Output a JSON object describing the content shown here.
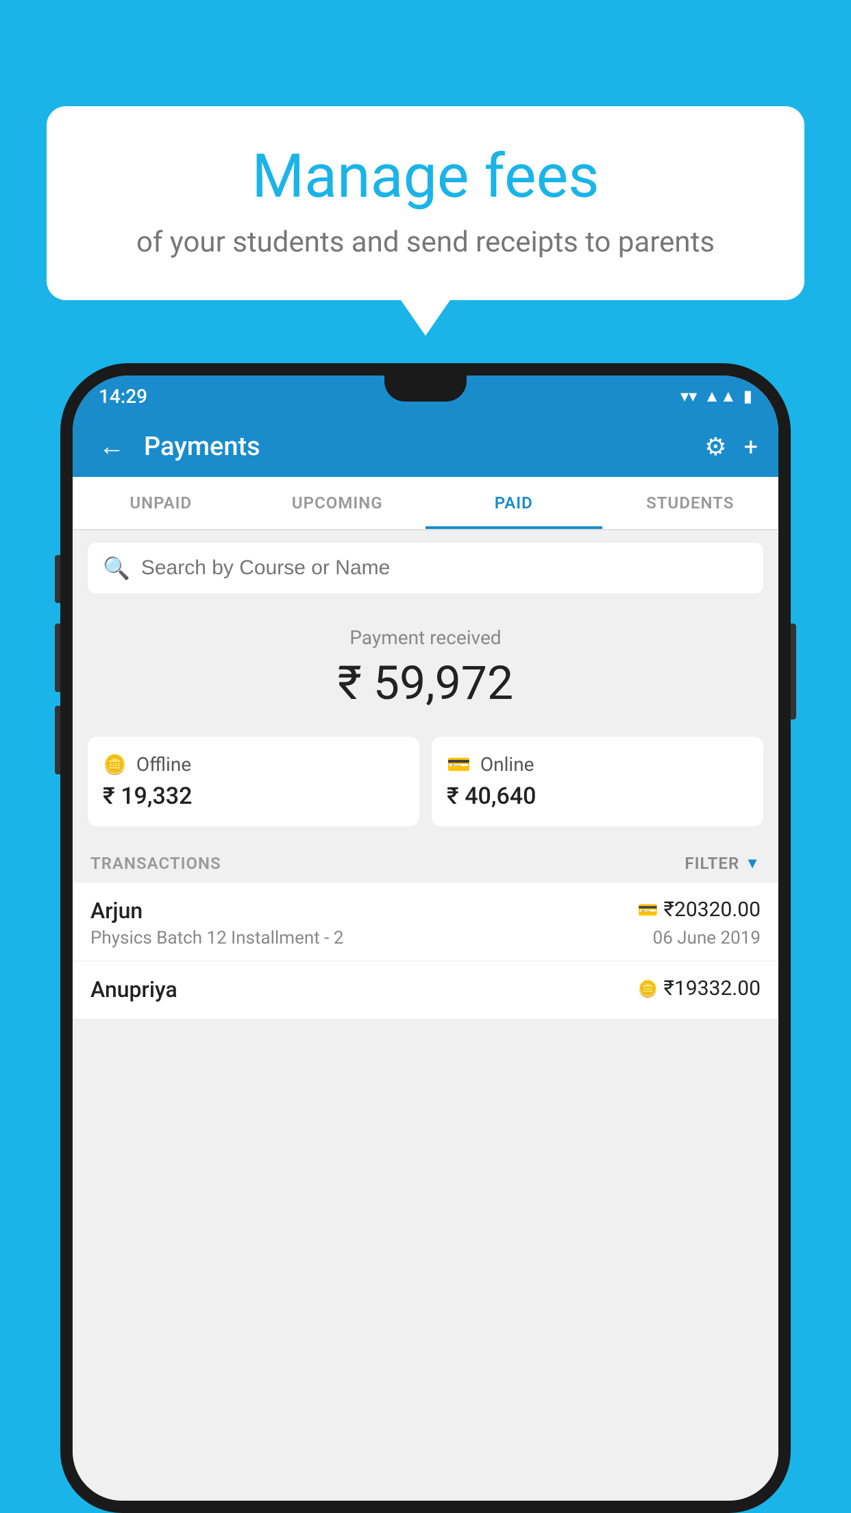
{
  "page": {
    "background_color": "#1ab4e8"
  },
  "speech_bubble": {
    "title": "Manage fees",
    "subtitle": "of your students and send receipts to parents"
  },
  "status_bar": {
    "time": "14:29"
  },
  "app_bar": {
    "title": "Payments",
    "back_label": "←",
    "gear_label": "⚙",
    "plus_label": "+"
  },
  "tabs": [
    {
      "id": "unpaid",
      "label": "UNPAID",
      "active": false
    },
    {
      "id": "upcoming",
      "label": "UPCOMING",
      "active": false
    },
    {
      "id": "paid",
      "label": "PAID",
      "active": true
    },
    {
      "id": "students",
      "label": "STUDENTS",
      "active": false
    }
  ],
  "search": {
    "placeholder": "Search by Course or Name"
  },
  "payment_received": {
    "label": "Payment received",
    "amount": "₹ 59,972"
  },
  "payment_cards": [
    {
      "type": "Offline",
      "amount": "₹ 19,332",
      "icon": "offline"
    },
    {
      "type": "Online",
      "amount": "₹ 40,640",
      "icon": "online"
    }
  ],
  "transactions_section": {
    "label": "TRANSACTIONS",
    "filter_label": "FILTER"
  },
  "transactions": [
    {
      "name": "Arjun",
      "course": "Physics Batch 12 Installment - 2",
      "amount": "₹20320.00",
      "date": "06 June 2019",
      "payment_type": "online"
    },
    {
      "name": "Anupriya",
      "course": "",
      "amount": "₹19332.00",
      "date": "",
      "payment_type": "offline"
    }
  ]
}
